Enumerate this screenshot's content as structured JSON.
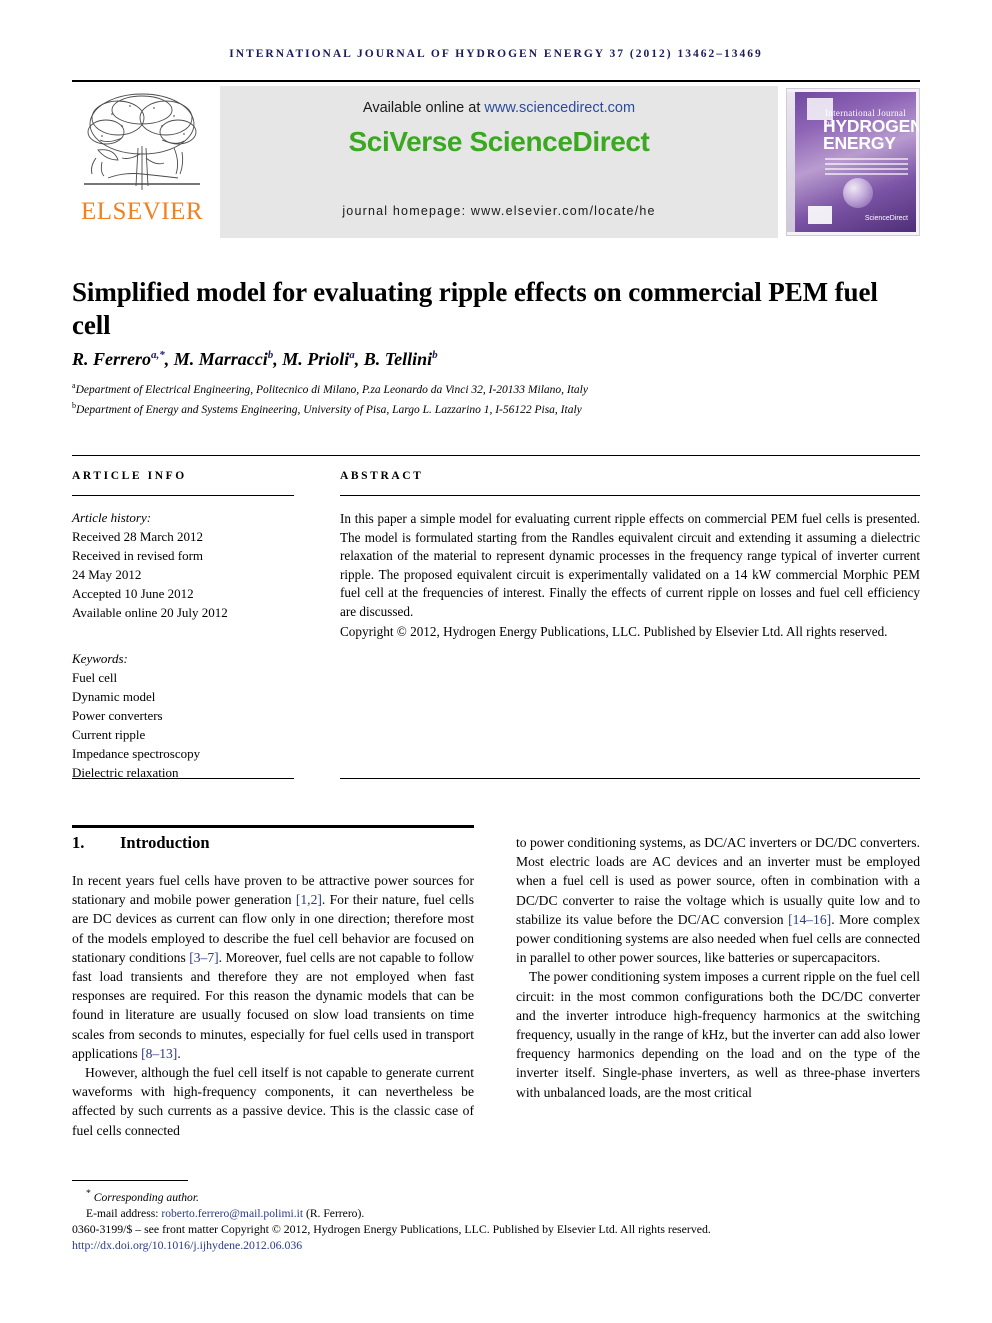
{
  "running_head": "International Journal of Hydrogen Energy 37 (2012) 13462–13469",
  "masthead": {
    "available_prefix": "Available online at ",
    "sciencedirect_url": "www.sciencedirect.com",
    "logo": "SciVerse ScienceDirect",
    "journal_homepage": "journal homepage: www.elsevier.com/locate/he",
    "publisher_name": "ELSEVIER",
    "cover": {
      "small_title": "International Journal of",
      "main_title_line1": "HYDROGEN",
      "main_title_line2": "ENERGY",
      "sciencedirect_mark": "ScienceDirect"
    }
  },
  "article": {
    "title": "Simplified model for evaluating ripple effects on commercial PEM fuel cell",
    "authors_html": "R. Ferrero<sup>a,*</sup>, M. Marracci<sup>b</sup>, M. Prioli<sup>a</sup>, B. Tellini<sup>b</sup>",
    "affiliation_a": "Department of Electrical Engineering, Politecnico di Milano, P.za Leonardo da Vinci 32, I-20133 Milano, Italy",
    "affiliation_b": "Department of Energy and Systems Engineering, University of Pisa, Largo L. Lazzarino 1, I-56122 Pisa, Italy"
  },
  "info": {
    "heading": "ARTICLE INFO",
    "history_label": "Article history:",
    "received": "Received 28 March 2012",
    "revised_label": "Received in revised form",
    "revised_date": "24 May 2012",
    "accepted": "Accepted 10 June 2012",
    "available_online": "Available online 20 July 2012",
    "keywords_label": "Keywords:",
    "keywords": [
      "Fuel cell",
      "Dynamic model",
      "Power converters",
      "Current ripple",
      "Impedance spectroscopy",
      "Dielectric relaxation"
    ]
  },
  "abstract": {
    "heading": "ABSTRACT",
    "text": "In this paper a simple model for evaluating current ripple effects on commercial PEM fuel cells is presented. The model is formulated starting from the Randles equivalent circuit and extending it assuming a dielectric relaxation of the material to represent dynamic processes in the frequency range typical of inverter current ripple. The proposed equivalent circuit is experimentally validated on a 14 kW commercial Morphic PEM fuel cell at the frequencies of interest. Finally the effects of current ripple on losses and fuel cell efficiency are discussed.",
    "copyright": "Copyright © 2012, Hydrogen Energy Publications, LLC. Published by Elsevier Ltd. All rights reserved."
  },
  "section": {
    "number": "1.",
    "title": "Introduction",
    "left_paragraph_1_a": "In recent years fuel cells have proven to be attractive power sources for stationary and mobile power generation ",
    "left_cite_1": "[1,2]",
    "left_paragraph_1_b": ". For their nature, fuel cells are DC devices as current can flow only in one direction; therefore most of the models employed to describe the fuel cell behavior are focused on stationary conditions ",
    "left_cite_2": "[3–7]",
    "left_paragraph_1_c": ". Moreover, fuel cells are not capable to follow fast load transients and therefore they are not employed when fast responses are required. For this reason the dynamic models that can be found in literature are usually focused on slow load transients on time scales from seconds to minutes, especially for fuel cells used in transport applications ",
    "left_cite_3": "[8–13]",
    "left_paragraph_1_d": ".",
    "left_paragraph_2": "However, although the fuel cell itself is not capable to generate current waveforms with high-frequency components, it can nevertheless be affected by such currents as a passive device. This is the classic case of fuel cells connected",
    "right_paragraph_1_a": "to power conditioning systems, as DC/AC inverters or DC/DC converters. Most electric loads are AC devices and an inverter must be employed when a fuel cell is used as power source, often in combination with a DC/DC converter to raise the voltage which is usually quite low and to stabilize its value before the DC/AC conversion ",
    "right_cite_1": "[14–16]",
    "right_paragraph_1_b": ". More complex power conditioning systems are also needed when fuel cells are connected in parallel to other power sources, like batteries or supercapacitors.",
    "right_paragraph_2": "The power conditioning system imposes a current ripple on the fuel cell circuit: in the most common configurations both the DC/DC converter and the inverter introduce high-frequency harmonics at the switching frequency, usually in the range of kHz, but the inverter can add also lower frequency harmonics depending on the load and on the type of the inverter itself. Single-phase inverters, as well as three-phase inverters with unbalanced loads, are the most critical"
  },
  "footer": {
    "corresponding_marker": "*",
    "corresponding_label": "Corresponding author.",
    "email_label": "E-mail address: ",
    "email": "roberto.ferrero@mail.polimi.it",
    "email_suffix": " (R. Ferrero).",
    "issn_line": "0360-3199/$ – see front matter Copyright © 2012, Hydrogen Energy Publications, LLC. Published by Elsevier Ltd. All rights reserved.",
    "doi": "http://dx.doi.org/10.1016/j.ijhydene.2012.06.036"
  },
  "colors": {
    "running_head": "#1a1a5e",
    "link": "#2a3a87",
    "sciencedirect_green": "#3aa821",
    "elsevier_orange": "#f08122",
    "band_gray": "#e6e6e6"
  }
}
